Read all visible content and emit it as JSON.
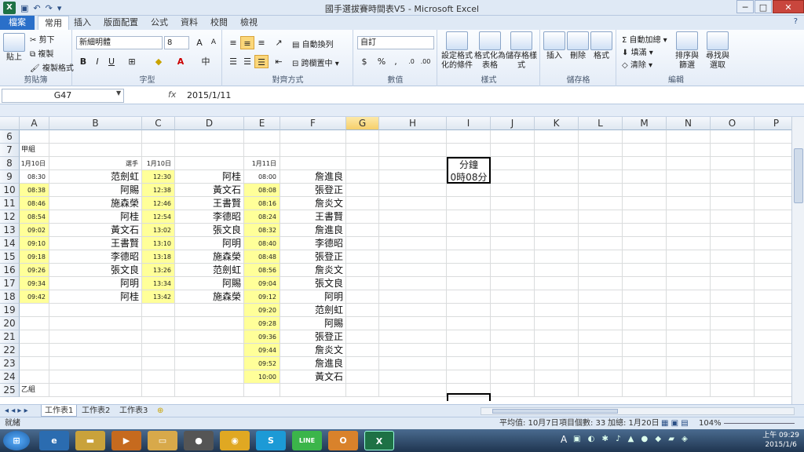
{
  "window": {
    "title": "國手選拔賽時間表V5 - Microsoft Excel",
    "minimize": "─",
    "maximize": "□",
    "close": "✕"
  },
  "ribbon_tabs": [
    "檔案",
    "常用",
    "插入",
    "版面配置",
    "公式",
    "資料",
    "校閱",
    "檢視"
  ],
  "ribbon": {
    "clipboard": {
      "paste": "貼上",
      "cut": "剪下",
      "copy": "複製",
      "format_painter": "複製格式",
      "group": "剪貼簿"
    },
    "font": {
      "name": "新細明體",
      "size": "8",
      "bold": "B",
      "italic": "I",
      "underline": "U",
      "group": "字型",
      "grow": "A",
      "shrink": "A"
    },
    "align": {
      "wrap": "自動換列",
      "merge": "跨欄置中",
      "group": "對齊方式"
    },
    "number": {
      "format": "自訂",
      "percent": "%",
      "comma": ",",
      "group": "數值"
    },
    "styles": {
      "cond": "設定格式化的條件",
      "table": "格式化為表格",
      "cell": "儲存格樣式",
      "group": "樣式"
    },
    "cells": {
      "insert": "插入",
      "delete": "刪除",
      "format": "格式",
      "group": "儲存格"
    },
    "edit": {
      "autosum": "自動加總",
      "fill": "填滿",
      "clear": "清除",
      "sort": "排序與篩選",
      "find": "尋找與選取",
      "group": "編輯"
    }
  },
  "formula_bar": {
    "name_box": "G47",
    "fx": "fx",
    "value": "2015/1/11"
  },
  "columns": [
    "A",
    "B",
    "C",
    "D",
    "E",
    "F",
    "G",
    "H",
    "I",
    "J",
    "K",
    "L",
    "M",
    "N",
    "O",
    "P"
  ],
  "rows": [
    "6",
    "7",
    "8",
    "9",
    "10",
    "11",
    "12",
    "13",
    "14",
    "15",
    "16",
    "17",
    "18",
    "19",
    "20",
    "21",
    "22",
    "23",
    "24",
    "25"
  ],
  "sheet": {
    "group_a": "甲組",
    "group_b": "乙組",
    "hdr_a": "1月10日",
    "hdr_b": "選手",
    "hdr_c": "1月10日",
    "hdr_e": "1月11日",
    "colA": [
      "08:30",
      "08:38",
      "08:46",
      "08:54",
      "09:02",
      "09:10",
      "09:18",
      "09:26",
      "09:34",
      "09:42"
    ],
    "colB": [
      "范劍虹",
      "阿賜",
      "施森榮",
      "阿桂",
      "黃文石",
      "王書賢",
      "李德昭",
      "張文良",
      "阿明",
      "阿桂"
    ],
    "colC": [
      "12:30",
      "12:38",
      "12:46",
      "12:54",
      "13:02",
      "13:10",
      "13:18",
      "13:26",
      "13:34",
      "13:42"
    ],
    "colD": [
      "阿桂",
      "黃文石",
      "王書賢",
      "李德昭",
      "張文良",
      "阿明",
      "施森榮",
      "范劍虹",
      "阿賜",
      "施森榮"
    ],
    "colE": [
      "08:00",
      "08:08",
      "08:16",
      "08:24",
      "08:32",
      "08:40",
      "08:48",
      "08:56",
      "09:04",
      "09:12",
      "09:20",
      "09:28",
      "09:36",
      "09:44",
      "09:52",
      "10:00"
    ],
    "colF": [
      "詹進良",
      "張登正",
      "詹炎文",
      "王書賢",
      "詹進良",
      "李德昭",
      "張登正",
      "詹炎文",
      "張文良",
      "阿明",
      "范劍虹",
      "阿賜",
      "張登正",
      "詹炎文",
      "詹進良",
      "黃文石"
    ],
    "box_title": "分鐘",
    "box_value": "0時08分"
  },
  "sheet_tabs": [
    "工作表1",
    "工作表2",
    "工作表3"
  ],
  "status": {
    "ready": "就緒",
    "average": "平均值: 10月7日",
    "count": "項目個數: 33",
    "sum": "加總: 1月20日",
    "zoom": "104%"
  },
  "taskbar": {
    "time": "上午 09:29",
    "date": "2015/1/6",
    "lang": "A"
  }
}
